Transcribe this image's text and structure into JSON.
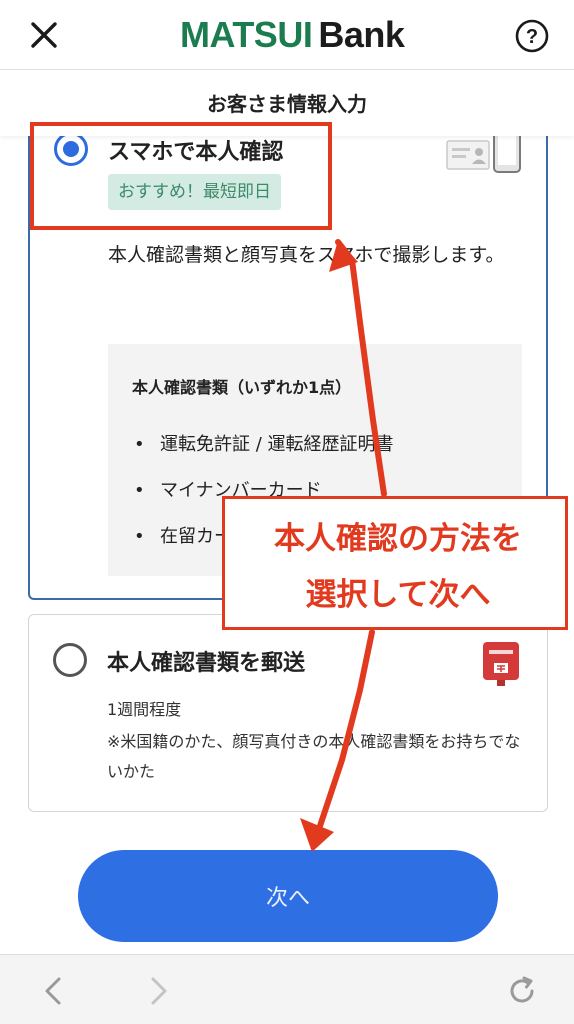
{
  "header": {
    "logo_part1": "MATSUI",
    "logo_part2": "Bank",
    "close_icon": "close-icon",
    "help_icon": "help-icon"
  },
  "sub_header": {
    "title": "お客さま情報入力"
  },
  "option_smartphone": {
    "selected": true,
    "title": "スマホで本人確認",
    "badge": "おすすめ！最短即日",
    "description": "本人確認書類と顔写真をスマホで撮影します。",
    "icons": [
      "id-card-icon",
      "smartphone-icon"
    ],
    "docs": {
      "title": "本人確認書類（いずれか1点）",
      "items": [
        "運転免許証 / 運転経歴証明書",
        "マイナンバーカード",
        "在留カード"
      ]
    }
  },
  "option_mail": {
    "selected": false,
    "title": "本人確認書類を郵送",
    "duration": "1週間程度",
    "note": "※米国籍のかた、顔写真付きの本人確認書類をお持ちでないかた",
    "icon": "postbox-icon"
  },
  "next_button": {
    "label": "次へ"
  },
  "annotation": {
    "line1": "本人確認の方法を",
    "line2": "選択して次へ",
    "color": "#e23a1f"
  },
  "browser_bar": {
    "back_icon": "chevron-left-icon",
    "forward_icon": "chevron-right-icon",
    "reload_icon": "reload-icon"
  },
  "colors": {
    "brand_green": "#1b7d4f",
    "primary_blue": "#2f6fe4",
    "selected_border": "#3a6aa8",
    "badge_bg": "#d4ebe3",
    "badge_text": "#3c8a6a"
  }
}
